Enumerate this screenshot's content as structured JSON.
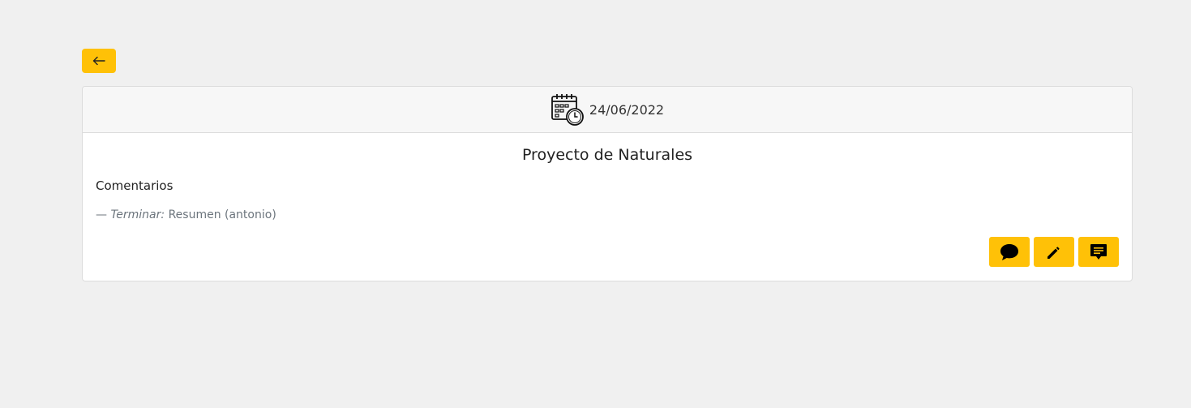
{
  "toolbar": {
    "back_icon": "arrow-left-icon"
  },
  "card": {
    "header": {
      "icon": "calendar-clock-icon",
      "date": "24/06/2022"
    },
    "title": "Proyecto de Naturales",
    "comments_heading": "Comentarios",
    "comments": [
      {
        "dash": "—",
        "label": "Terminar:",
        "text": "Resumen (antonio)"
      }
    ],
    "actions": [
      {
        "icon": "chat-bubble-icon"
      },
      {
        "icon": "pencil-icon"
      },
      {
        "icon": "message-icon"
      }
    ]
  },
  "colors": {
    "accent": "#ffc107",
    "background": "#f0f0f0",
    "card_header": "#f7f7f7"
  }
}
